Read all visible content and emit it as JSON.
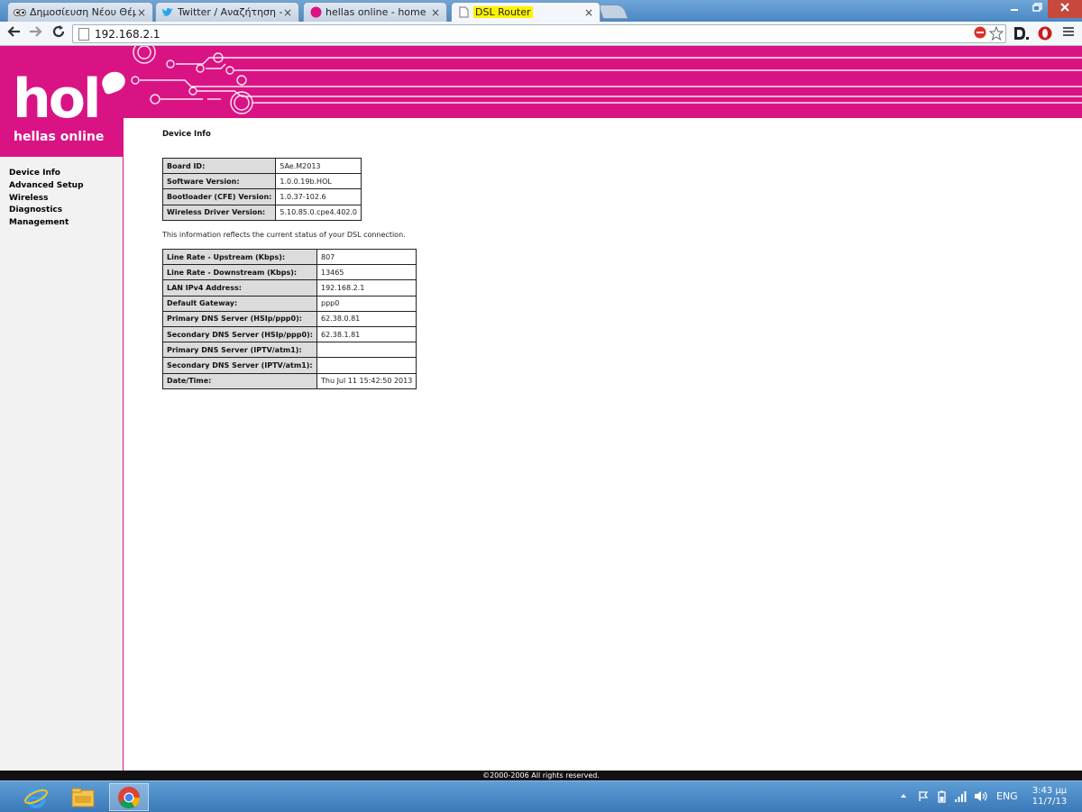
{
  "browser": {
    "tabs": [
      {
        "label": "Δημοσίευση Νέου Θέματο",
        "favicon": "forum-icon",
        "active": false
      },
      {
        "label": "Twitter / Αναζήτηση - #ka",
        "favicon": "twitter-bird-icon",
        "active": false
      },
      {
        "label": "hellas online - home",
        "favicon": "hol-icon",
        "active": false
      },
      {
        "label": "DSL Router",
        "favicon": "page-icon",
        "active": true
      }
    ],
    "url": "192.168.2.1",
    "tab_close_glyph": "×"
  },
  "router": {
    "brand_logo": "hol",
    "brand_sub": "hellas online",
    "nav": [
      "Device Info",
      "Advanced Setup",
      "Wireless",
      "Diagnostics",
      "Management"
    ],
    "page_title": "Device Info",
    "device_table": [
      {
        "label": "Board ID:",
        "value": "5Ae.M2013"
      },
      {
        "label": "Software Version:",
        "value": "1.0.0.19b.HOL"
      },
      {
        "label": "Bootloader (CFE) Version:",
        "value": "1.0.37-102.6"
      },
      {
        "label": "Wireless Driver Version:",
        "value": "5.10.85.0.cpe4.402.0"
      }
    ],
    "status_note": "This information reflects the current status of your DSL connection.",
    "status_table": [
      {
        "label": "Line Rate - Upstream (Kbps):",
        "value": "807"
      },
      {
        "label": "Line Rate - Downstream (Kbps):",
        "value": "13465"
      },
      {
        "label": "LAN IPv4 Address:",
        "value": "192.168.2.1"
      },
      {
        "label": "Default Gateway:",
        "value": "ppp0"
      },
      {
        "label": "Primary DNS Server  (HSIp/ppp0):",
        "value": "62.38.0.81"
      },
      {
        "label": "Secondary DNS Server  (HSIp/ppp0):",
        "value": "62.38.1.81"
      },
      {
        "label": "Primary DNS Server  (IPTV/atm1):",
        "value": ""
      },
      {
        "label": "Secondary DNS Server  (IPTV/atm1):",
        "value": ""
      },
      {
        "label": "Date/Time:",
        "value": "Thu Jul 11 15:42:50 2013"
      }
    ],
    "footer": "©2000-2006 All rights reserved."
  },
  "taskbar": {
    "language": "ENG",
    "time": "3:43 μμ",
    "date": "11/7/13"
  },
  "colors": {
    "brand_magenta": "#da1384",
    "table_label_bg": "#dcdcdc",
    "taskbar_blue": "#3a78b8"
  }
}
